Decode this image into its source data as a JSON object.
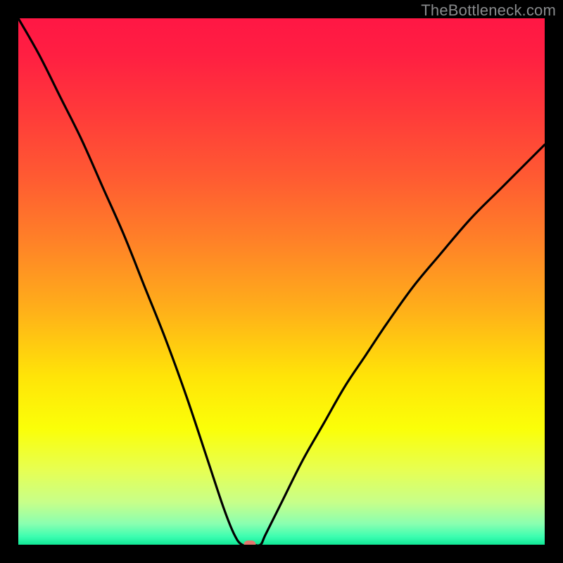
{
  "watermark": "TheBottleneck.com",
  "chart_data": {
    "type": "line",
    "title": "",
    "xlabel": "",
    "ylabel": "",
    "xlim": [
      0,
      100
    ],
    "ylim": [
      0,
      100
    ],
    "grid": false,
    "legend": false,
    "series": [
      {
        "name": "curve",
        "x": [
          0,
          4,
          8,
          12,
          16,
          20,
          24,
          28,
          32,
          36,
          39,
          41,
          42.5,
          44.5,
          46,
          47,
          50,
          54,
          58,
          62,
          66,
          70,
          75,
          80,
          86,
          92,
          100
        ],
        "y": [
          100,
          93,
          85,
          77,
          68,
          59,
          49,
          39,
          28,
          16,
          7,
          2,
          0,
          0,
          0,
          2,
          8,
          16,
          23,
          30,
          36,
          42,
          49,
          55,
          62,
          68,
          76
        ]
      }
    ],
    "gradient_stops": [
      {
        "offset": 0.0,
        "color": "#ff1744"
      },
      {
        "offset": 0.07,
        "color": "#ff1f42"
      },
      {
        "offset": 0.18,
        "color": "#ff3a3a"
      },
      {
        "offset": 0.3,
        "color": "#ff5a32"
      },
      {
        "offset": 0.42,
        "color": "#ff8028"
      },
      {
        "offset": 0.55,
        "color": "#ffae1a"
      },
      {
        "offset": 0.68,
        "color": "#ffe408"
      },
      {
        "offset": 0.78,
        "color": "#fbff08"
      },
      {
        "offset": 0.86,
        "color": "#e6ff54"
      },
      {
        "offset": 0.92,
        "color": "#c7ff8a"
      },
      {
        "offset": 0.96,
        "color": "#8affb0"
      },
      {
        "offset": 0.985,
        "color": "#3bfdb0"
      },
      {
        "offset": 1.0,
        "color": "#11e896"
      }
    ],
    "marker": {
      "x": 44,
      "y": 0,
      "color": "#e2776e"
    },
    "curve_color": "#000000",
    "curve_width": 3.2
  }
}
